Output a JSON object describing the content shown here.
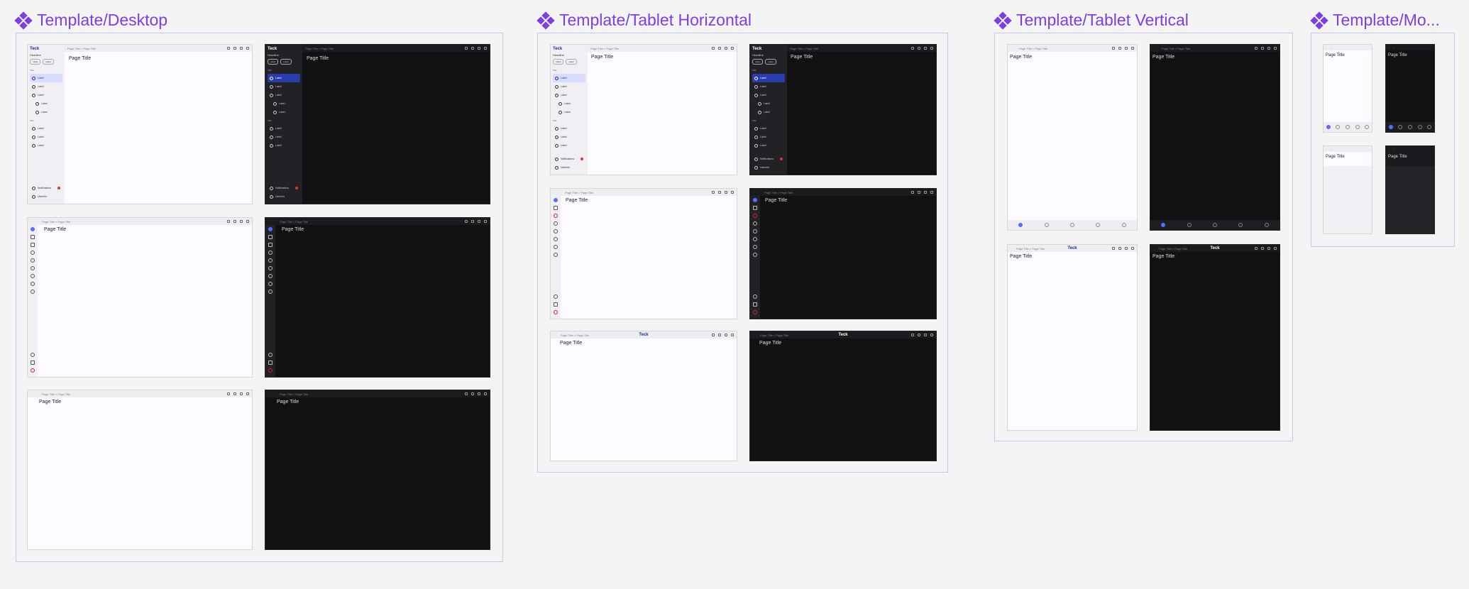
{
  "sections": {
    "desktop": "Template/Desktop",
    "tablet_h": "Template/Tablet Horizontal",
    "tablet_v": "Template/Tablet Vertical",
    "mobile": "Template/Mo..."
  },
  "brand": "Teck",
  "page_title": "Page Title",
  "breadcrumb": "Page Title > Page Title",
  "drawer": {
    "headline": "Headline",
    "chip_a": "Label",
    "chip_b": "Label",
    "group_label": "Title",
    "item_label": "Label",
    "notifications": "Notifications",
    "userinfo": "Userinfo"
  },
  "colors": {
    "accent": "#7b3fe4",
    "primary": "#1b2f9c",
    "dark_surface": "#111113",
    "light_surface": "#fdfbff"
  }
}
